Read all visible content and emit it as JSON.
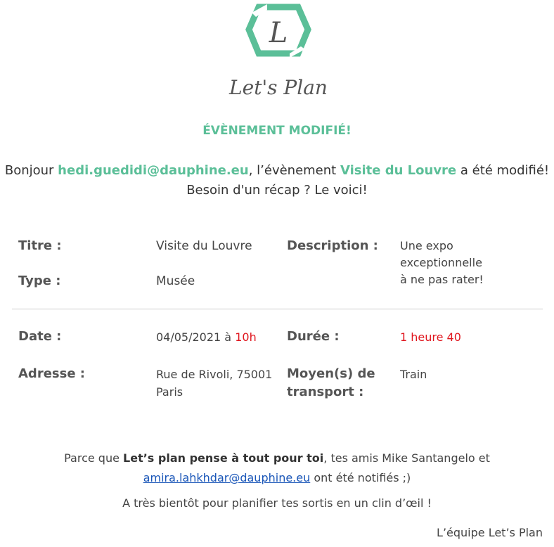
{
  "logo": {
    "letter": "L",
    "brand_text": "Let's Plan",
    "colors": {
      "green": "#5bbf98",
      "text": "#555555"
    }
  },
  "headline": "ÉVÈNEMENT MODIFIÉ!",
  "intro": {
    "greeting": "Bonjour ",
    "email": "hedi.guedidi@dauphine.eu",
    "mid": ", l’évènement ",
    "event_name": "Visite du Louvre",
    "end": " a été modifié!",
    "line2": "Besoin d'un récap ? Le voici!"
  },
  "details": {
    "title_label": "Titre :",
    "title_value": "Visite du Louvre",
    "type_label": "Type :",
    "type_value": "Musée",
    "description_label": "Description :",
    "description_lines": [
      "Une expo",
      "exceptionnelle",
      "à ne pas rater!"
    ],
    "date_label": "Date :",
    "date_value": "04/05/2021 à ",
    "time_value": "10h",
    "duration_label": "Durée :",
    "duration_value": "1 heure 40",
    "address_label": "Adresse :",
    "address_lines": [
      "Rue de Rivoli, 75001",
      "Paris"
    ],
    "transport_label_lines": [
      "Moyen(s) de",
      "transport :"
    ],
    "transport_value": "Train"
  },
  "footer": {
    "part1": "Parce que ",
    "bold": "Let’s plan pense à tout pour toi",
    "part2": ", tes amis Mike Santangelo et",
    "link_email": "amira.lahkhdar@dauphine.eu",
    "part3": " ont été notifiés ;)",
    "line2": "A très bientôt pour planifier tes sortis en un clin d’œil !",
    "signature": "L’équipe Let’s Plan"
  },
  "colors": {
    "accent": "#5bbf98",
    "highlight_red": "#e0161e",
    "link": "#1a56b8"
  }
}
